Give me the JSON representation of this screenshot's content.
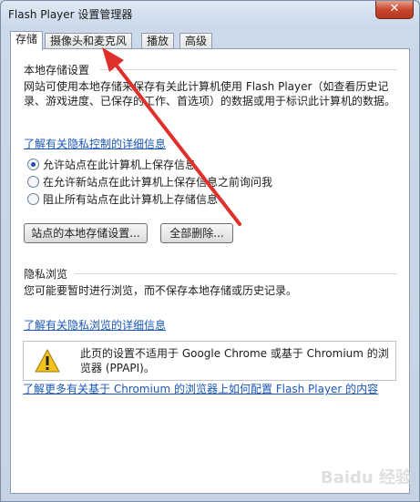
{
  "window": {
    "title": "Flash Player 设置管理器",
    "close_label": "✕"
  },
  "tabs": [
    {
      "label": "存储",
      "active": true
    },
    {
      "label": "摄像头和麦克风",
      "active": false
    },
    {
      "label": "播放",
      "active": false
    },
    {
      "label": "高级",
      "active": false
    }
  ],
  "local_storage": {
    "heading": "本地存储设置",
    "description": "网站可使用本地存储来保存有关此计算机使用 Flash Player（如查看历史记录、游戏进度、已保存的工作、首选项）的数据或用于标识此计算机的数据。",
    "privacy_link": "了解有关隐私控制的详细信息",
    "radio_options": [
      {
        "label": "允许站点在此计算机上保存信息",
        "checked": true
      },
      {
        "label": "在允许新站点在此计算机上保存信息之前询问我",
        "checked": false
      },
      {
        "label": "阻止所有站点在此计算机上存储信息",
        "checked": false
      }
    ],
    "site_settings_button": "站点的本地存储设置...",
    "delete_all_button": "全部删除..."
  },
  "private_browsing": {
    "heading": "隐私浏览",
    "description": "您可能要暂时进行浏览，而不保存本地存储或历史记录。",
    "link": "了解有关隐私浏览的详细信息"
  },
  "warning": {
    "text": "此页的设置不适用于 Google Chrome 或基于 Chromium 的浏览器 (PPAPI)。",
    "icon": "warning-icon"
  },
  "chromium_link": "了解更多有关基于 Chromium 的浏览器上如何配置 Flash Player 的内容",
  "watermark": "Baidu 经验",
  "colors": {
    "link": "#1a57b8",
    "arrow": "#e0302b"
  }
}
